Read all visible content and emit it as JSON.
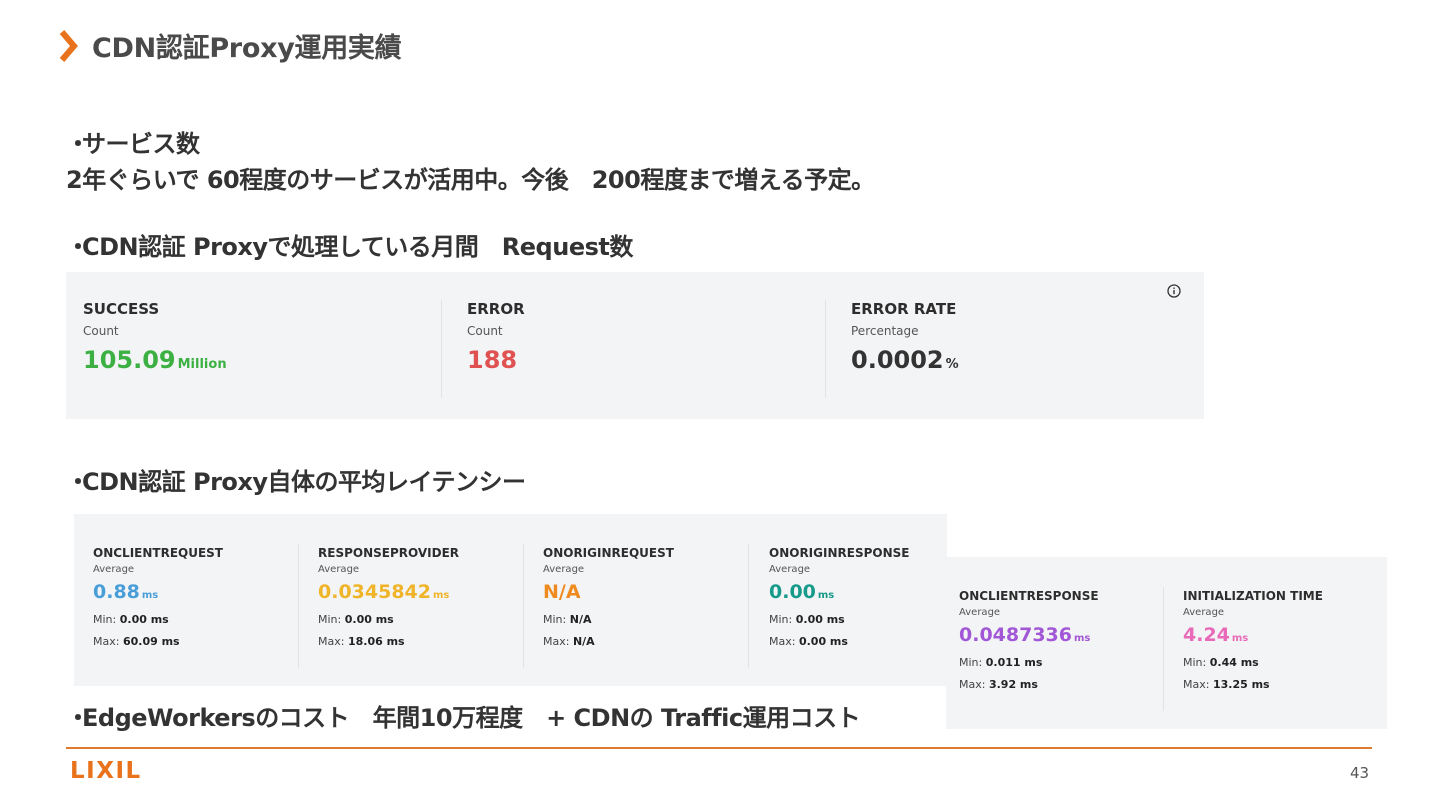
{
  "slide": {
    "title": "CDN認証Proxy運用実績",
    "page_number": "43",
    "logo_text": "LIXIL"
  },
  "section1": {
    "bullet": "・",
    "heading": "サービス数",
    "body": "2年ぐらいで 60程度のサービスが活用中。今後　200程度まで増える予定。"
  },
  "section2": {
    "bullet": "・",
    "heading": "CDN認証 Proxyで処理している月間　Request数"
  },
  "request_panel": {
    "metrics": [
      {
        "name": "SUCCESS",
        "sub": "Count",
        "value": "105.09",
        "unit": "Million",
        "color": "#3cb043"
      },
      {
        "name": "ERROR",
        "sub": "Count",
        "value": "188",
        "unit": "",
        "color": "#e05252"
      },
      {
        "name": "ERROR RATE",
        "sub": "Percentage",
        "value": "0.0002",
        "unit": "%",
        "color": "#333333"
      }
    ]
  },
  "section3": {
    "bullet": "・",
    "heading": "CDN認証 Proxy自体の平均レイテンシー"
  },
  "latency_panel_1": {
    "metrics": [
      {
        "name": "ONCLIENTREQUEST",
        "sub": "Average",
        "value": "0.88",
        "unit": "ms",
        "color": "#4a9ed8",
        "min_label": "Min:",
        "min": "0.00 ms",
        "max_label": "Max:",
        "max": "60.09 ms"
      },
      {
        "name": "RESPONSEPROVIDER",
        "sub": "Average",
        "value": "0.0345842",
        "unit": "ms",
        "color": "#f0b429",
        "min_label": "Min:",
        "min": "0.00 ms",
        "max_label": "Max:",
        "max": "18.06 ms"
      },
      {
        "name": "ONORIGINREQUEST",
        "sub": "Average",
        "value": "N/A",
        "unit": "",
        "color": "#ef8a1e",
        "min_label": "Min:",
        "min": "N/A",
        "max_label": "Max:",
        "max": "N/A"
      },
      {
        "name": "ONORIGINRESPONSE",
        "sub": "Average",
        "value": "0.00",
        "unit": "ms",
        "color": "#169b8a",
        "min_label": "Min:",
        "min": "0.00 ms",
        "max_label": "Max:",
        "max": "0.00 ms"
      }
    ]
  },
  "latency_panel_2": {
    "metrics": [
      {
        "name": "ONCLIENTRESPONSE",
        "sub": "Average",
        "value": "0.0487336",
        "unit": "ms",
        "color": "#a257d6",
        "min_label": "Min:",
        "min": "0.011 ms",
        "max_label": "Max:",
        "max": "3.92 ms"
      },
      {
        "name": "INITIALIZATION TIME",
        "sub": "Average",
        "value": "4.24",
        "unit": "ms",
        "color": "#e86ab8",
        "min_label": "Min:",
        "min": "0.44 ms",
        "max_label": "Max:",
        "max": "13.25 ms"
      }
    ]
  },
  "section4": {
    "bullet": "・",
    "heading": "EdgeWorkersのコスト　年間10万程度　+ CDNの Traffic運用コスト"
  },
  "colors": {
    "accent": "#e07a2f",
    "logo": "#e8731c",
    "panel_bg": "#f3f4f6"
  },
  "icons": {
    "title_marker": "chevron-right-icon",
    "panel_info": "info-icon"
  }
}
